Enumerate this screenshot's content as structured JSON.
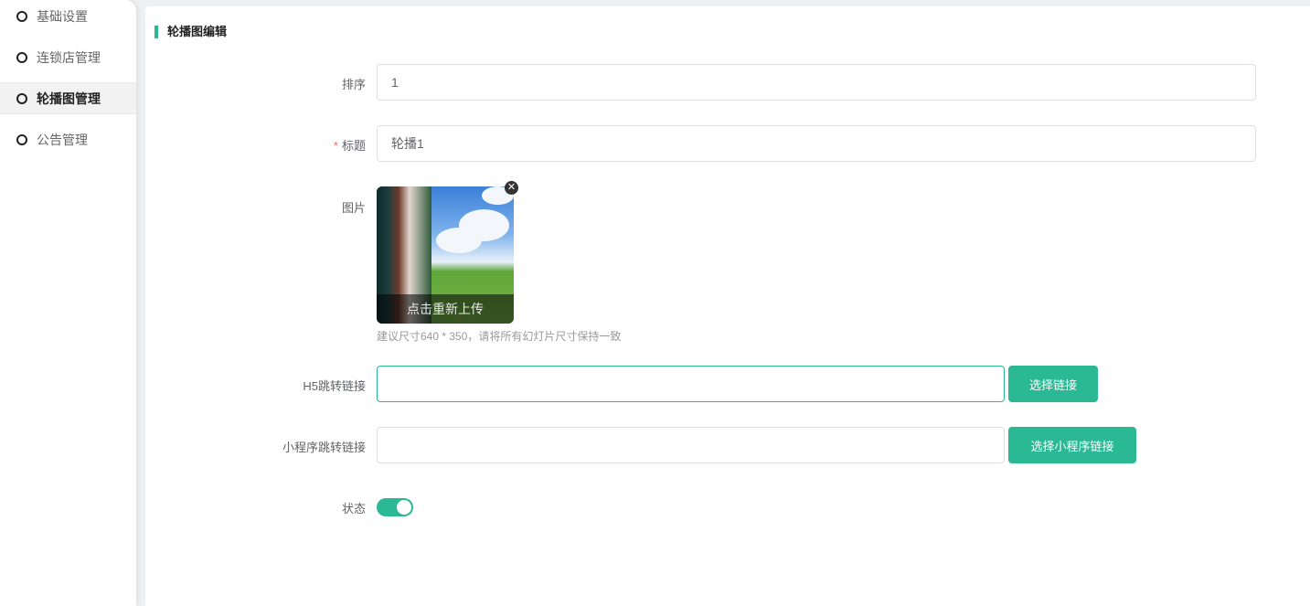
{
  "sidebar": {
    "items": [
      {
        "label": "基础设置"
      },
      {
        "label": "连锁店管理"
      },
      {
        "label": "轮播图管理",
        "active": true
      },
      {
        "label": "公告管理"
      }
    ]
  },
  "form": {
    "title": "轮播图编辑",
    "sort": {
      "label": "排序",
      "value": "1"
    },
    "name": {
      "required": "*",
      "label": "标题",
      "value": "轮播1"
    },
    "image": {
      "label": "图片",
      "reupload": "点击重新上传",
      "hint": "建议尺寸640 * 350，请将所有幻灯片尺寸保持一致"
    },
    "h5_link": {
      "label": "H5跳转链接",
      "value": "",
      "button": "选择链接"
    },
    "mp_link": {
      "label": "小程序跳转链接",
      "value": "",
      "button": "选择小程序链接"
    },
    "status": {
      "label": "状态",
      "on": true
    }
  },
  "colors": {
    "accent": "#2bb894"
  }
}
